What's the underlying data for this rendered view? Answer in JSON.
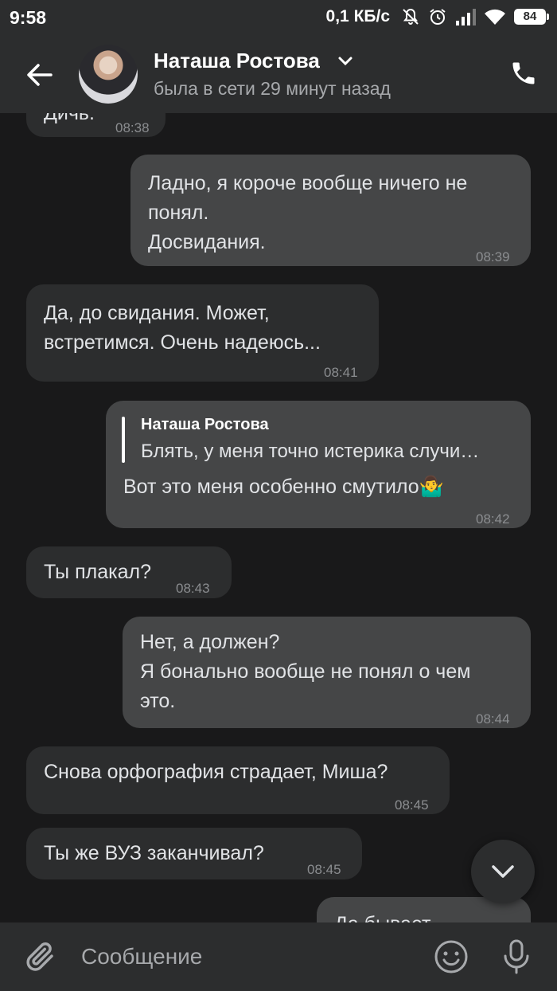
{
  "status_bar": {
    "time": "9:58",
    "speed": "0,1 КБ/с",
    "battery": "84"
  },
  "header": {
    "name": "Наташа Ростова",
    "status": "была в сети 29 минут назад"
  },
  "messages": [
    {
      "side": "in",
      "lines": [
        "Дичь."
      ],
      "time": "08:38"
    },
    {
      "side": "out",
      "lines": [
        "Ладно, я короче вообще ничего не",
        "понял.",
        "Досвидания."
      ],
      "time": "08:39"
    },
    {
      "side": "in",
      "lines": [
        "Да, до свидания. Может,",
        "встретимся. Очень надеюсь..."
      ],
      "time": "08:41"
    },
    {
      "side": "out",
      "reply": {
        "name": "Наташа Ростова",
        "text": "Блять, у меня точно истерика случи…"
      },
      "lines": [
        "Вот это меня особенно смутило🤷‍♂️"
      ],
      "time": "08:42"
    },
    {
      "side": "in",
      "lines": [
        "Ты плакал?"
      ],
      "time": "08:43"
    },
    {
      "side": "out",
      "lines": [
        "Нет, а должен?",
        "Я бонально вообще не понял о чем",
        "это."
      ],
      "time": "08:44"
    },
    {
      "side": "in",
      "lines": [
        "Снова орфография страдает, Миша?"
      ],
      "time": "08:45"
    },
    {
      "side": "in",
      "lines": [
        "Ты же ВУЗ заканчивал?"
      ],
      "time": "08:45"
    },
    {
      "side": "out",
      "lines": [
        "Да бывает..."
      ],
      "time": ""
    }
  ],
  "composer": {
    "placeholder": "Сообщение"
  },
  "colors": {
    "background": "#19191a",
    "incoming_bubble": "#2c2d2e",
    "outgoing_bubble": "#454647",
    "bar": "#2c2d2e",
    "text": "#e1e3e6",
    "muted_text": "#a7a9ac"
  },
  "icons": [
    "arrow-left-icon",
    "chevron-down-icon",
    "phone-icon",
    "paperclip-icon",
    "smile-icon",
    "microphone-icon",
    "scroll-down-icon",
    "mute-bell-icon",
    "alarm-icon",
    "signal-icon",
    "wifi-icon",
    "battery-icon"
  ]
}
